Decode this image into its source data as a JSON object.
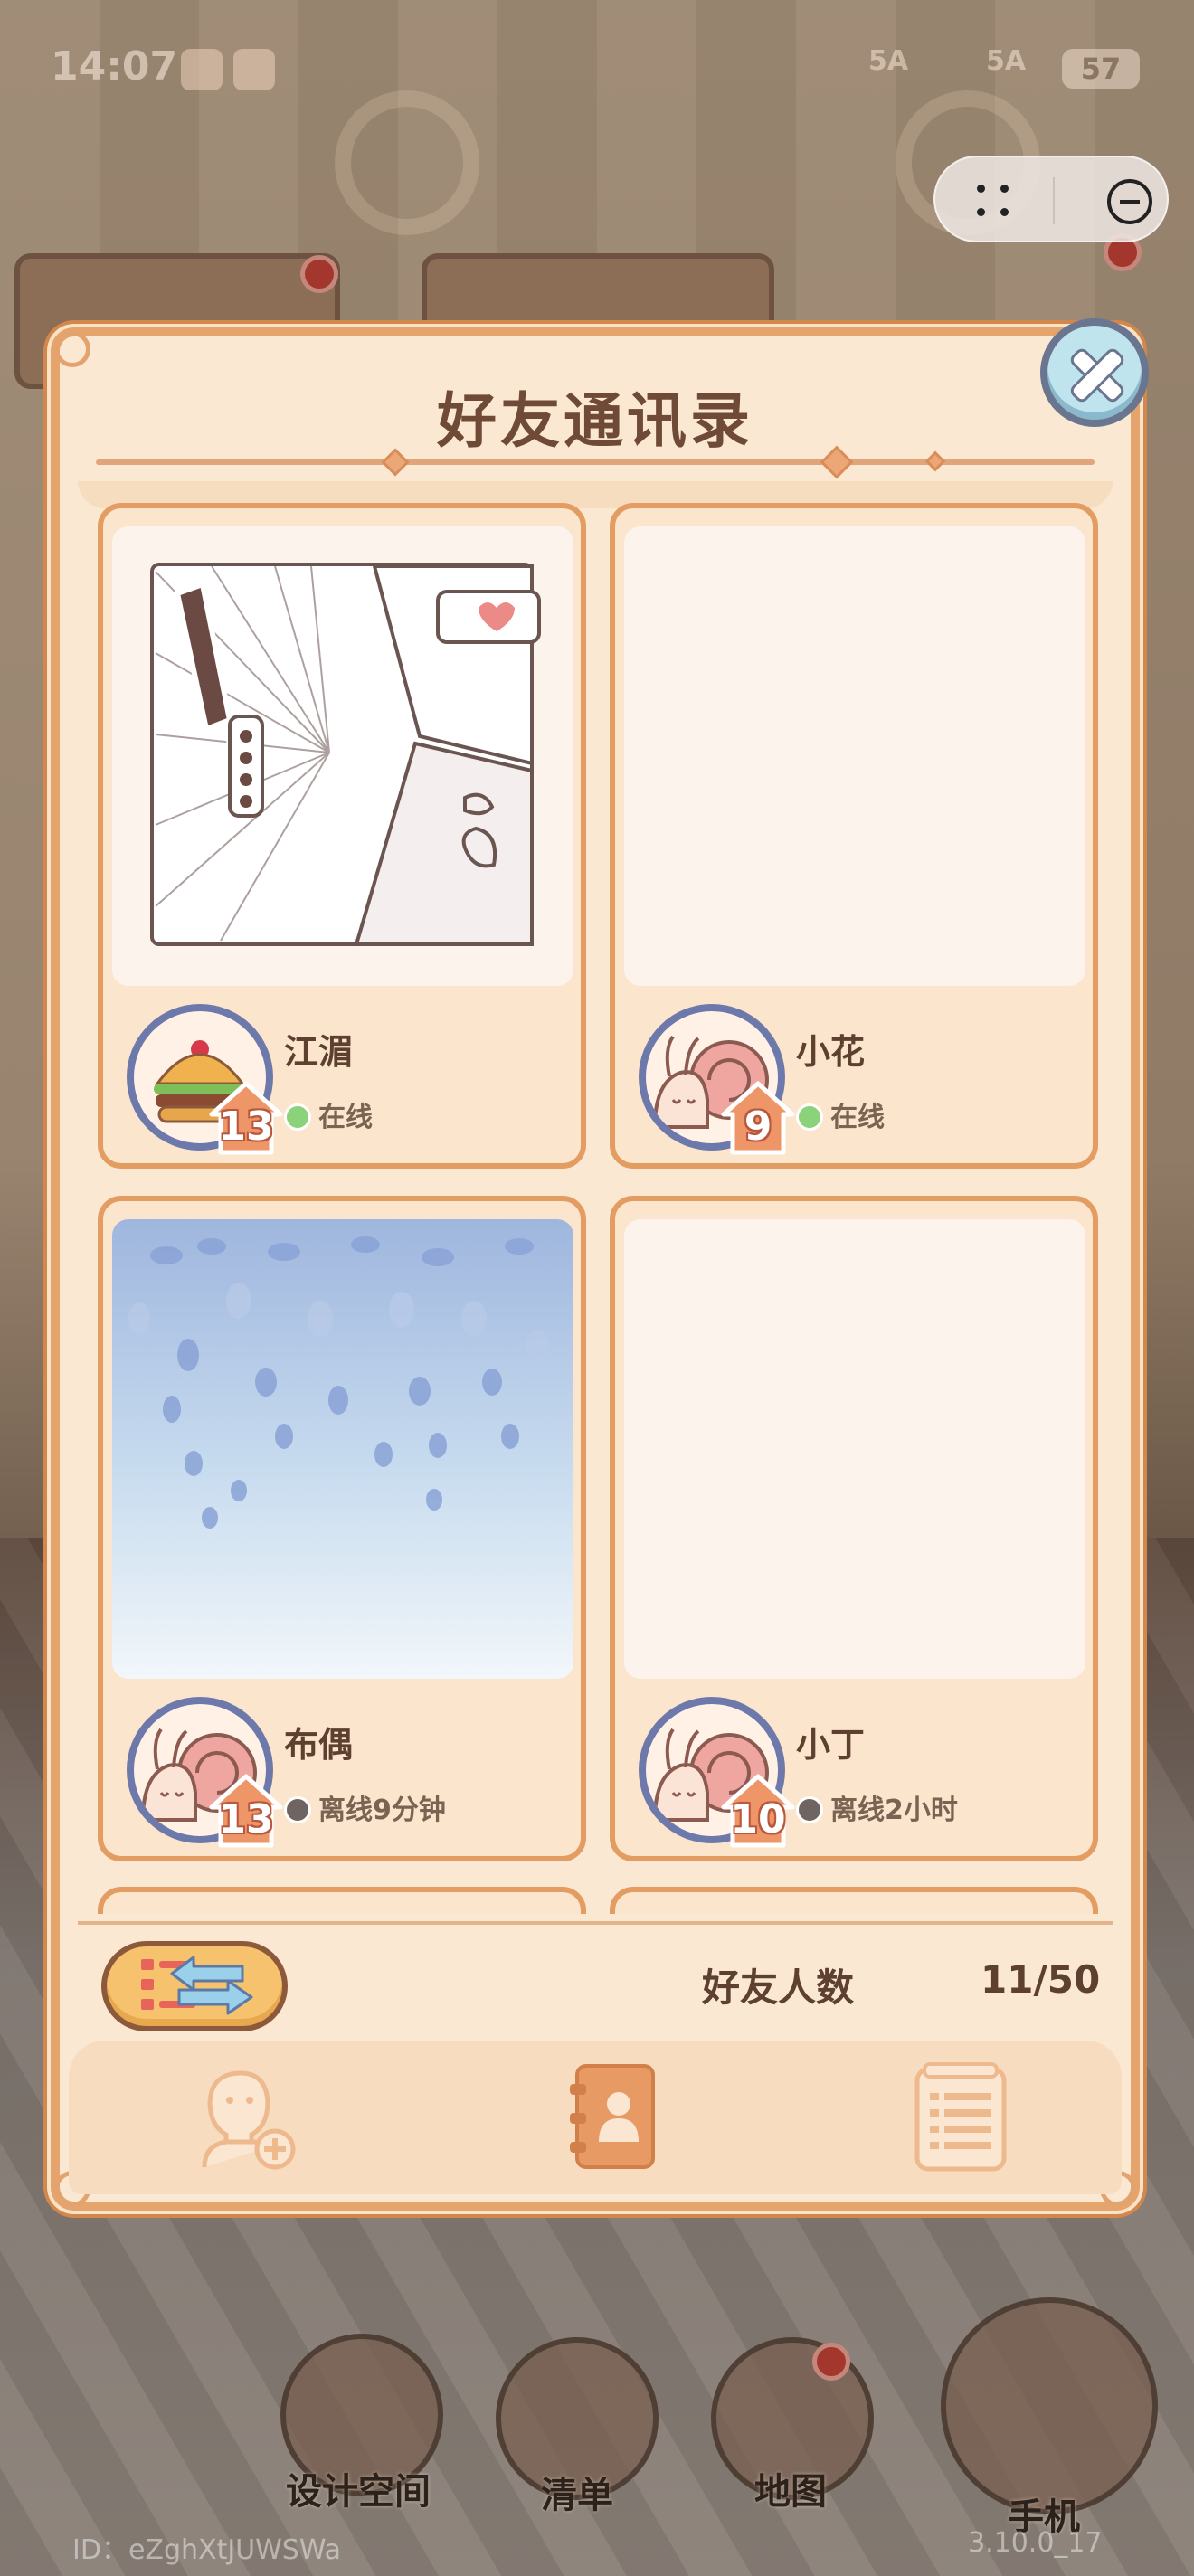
{
  "status_bar": {
    "time": "14:07",
    "network": "5A",
    "battery": "57"
  },
  "dialog": {
    "title": "好友通讯录",
    "friends": [
      {
        "name": "江湄",
        "level": "13",
        "status": "在线",
        "online": true,
        "avatar": "burger-avatar",
        "thumb": "comic-panel"
      },
      {
        "name": "小花",
        "level": "9",
        "status": "在线",
        "online": true,
        "avatar": "snail-avatar",
        "thumb": "blank"
      },
      {
        "name": "布偶",
        "level": "13",
        "status": "离线9分钟",
        "online": false,
        "avatar": "snail-avatar",
        "thumb": "wisteria"
      },
      {
        "name": "小丁",
        "level": "10",
        "status": "离线2小时",
        "online": false,
        "avatar": "snail-avatar",
        "thumb": "blank"
      }
    ],
    "friend_count_label": "好友人数",
    "friend_count_value": "11/50",
    "tabs": [
      {
        "icon": "add-friend-icon",
        "active": false
      },
      {
        "icon": "contacts-book-icon",
        "active": true
      },
      {
        "icon": "list-icon",
        "active": false
      }
    ]
  },
  "hud": {
    "design_space": "设计空间",
    "checklist": "清单",
    "map": "地图",
    "phone": "手机",
    "player_id": "ID：eZghXtJUWSWa",
    "version": "3.10.0_17"
  },
  "colors": {
    "frame": "#e39d62",
    "panel": "#fae8d2",
    "title": "#6f4a36",
    "online": "#8cd27b",
    "offline": "#6e6462"
  }
}
